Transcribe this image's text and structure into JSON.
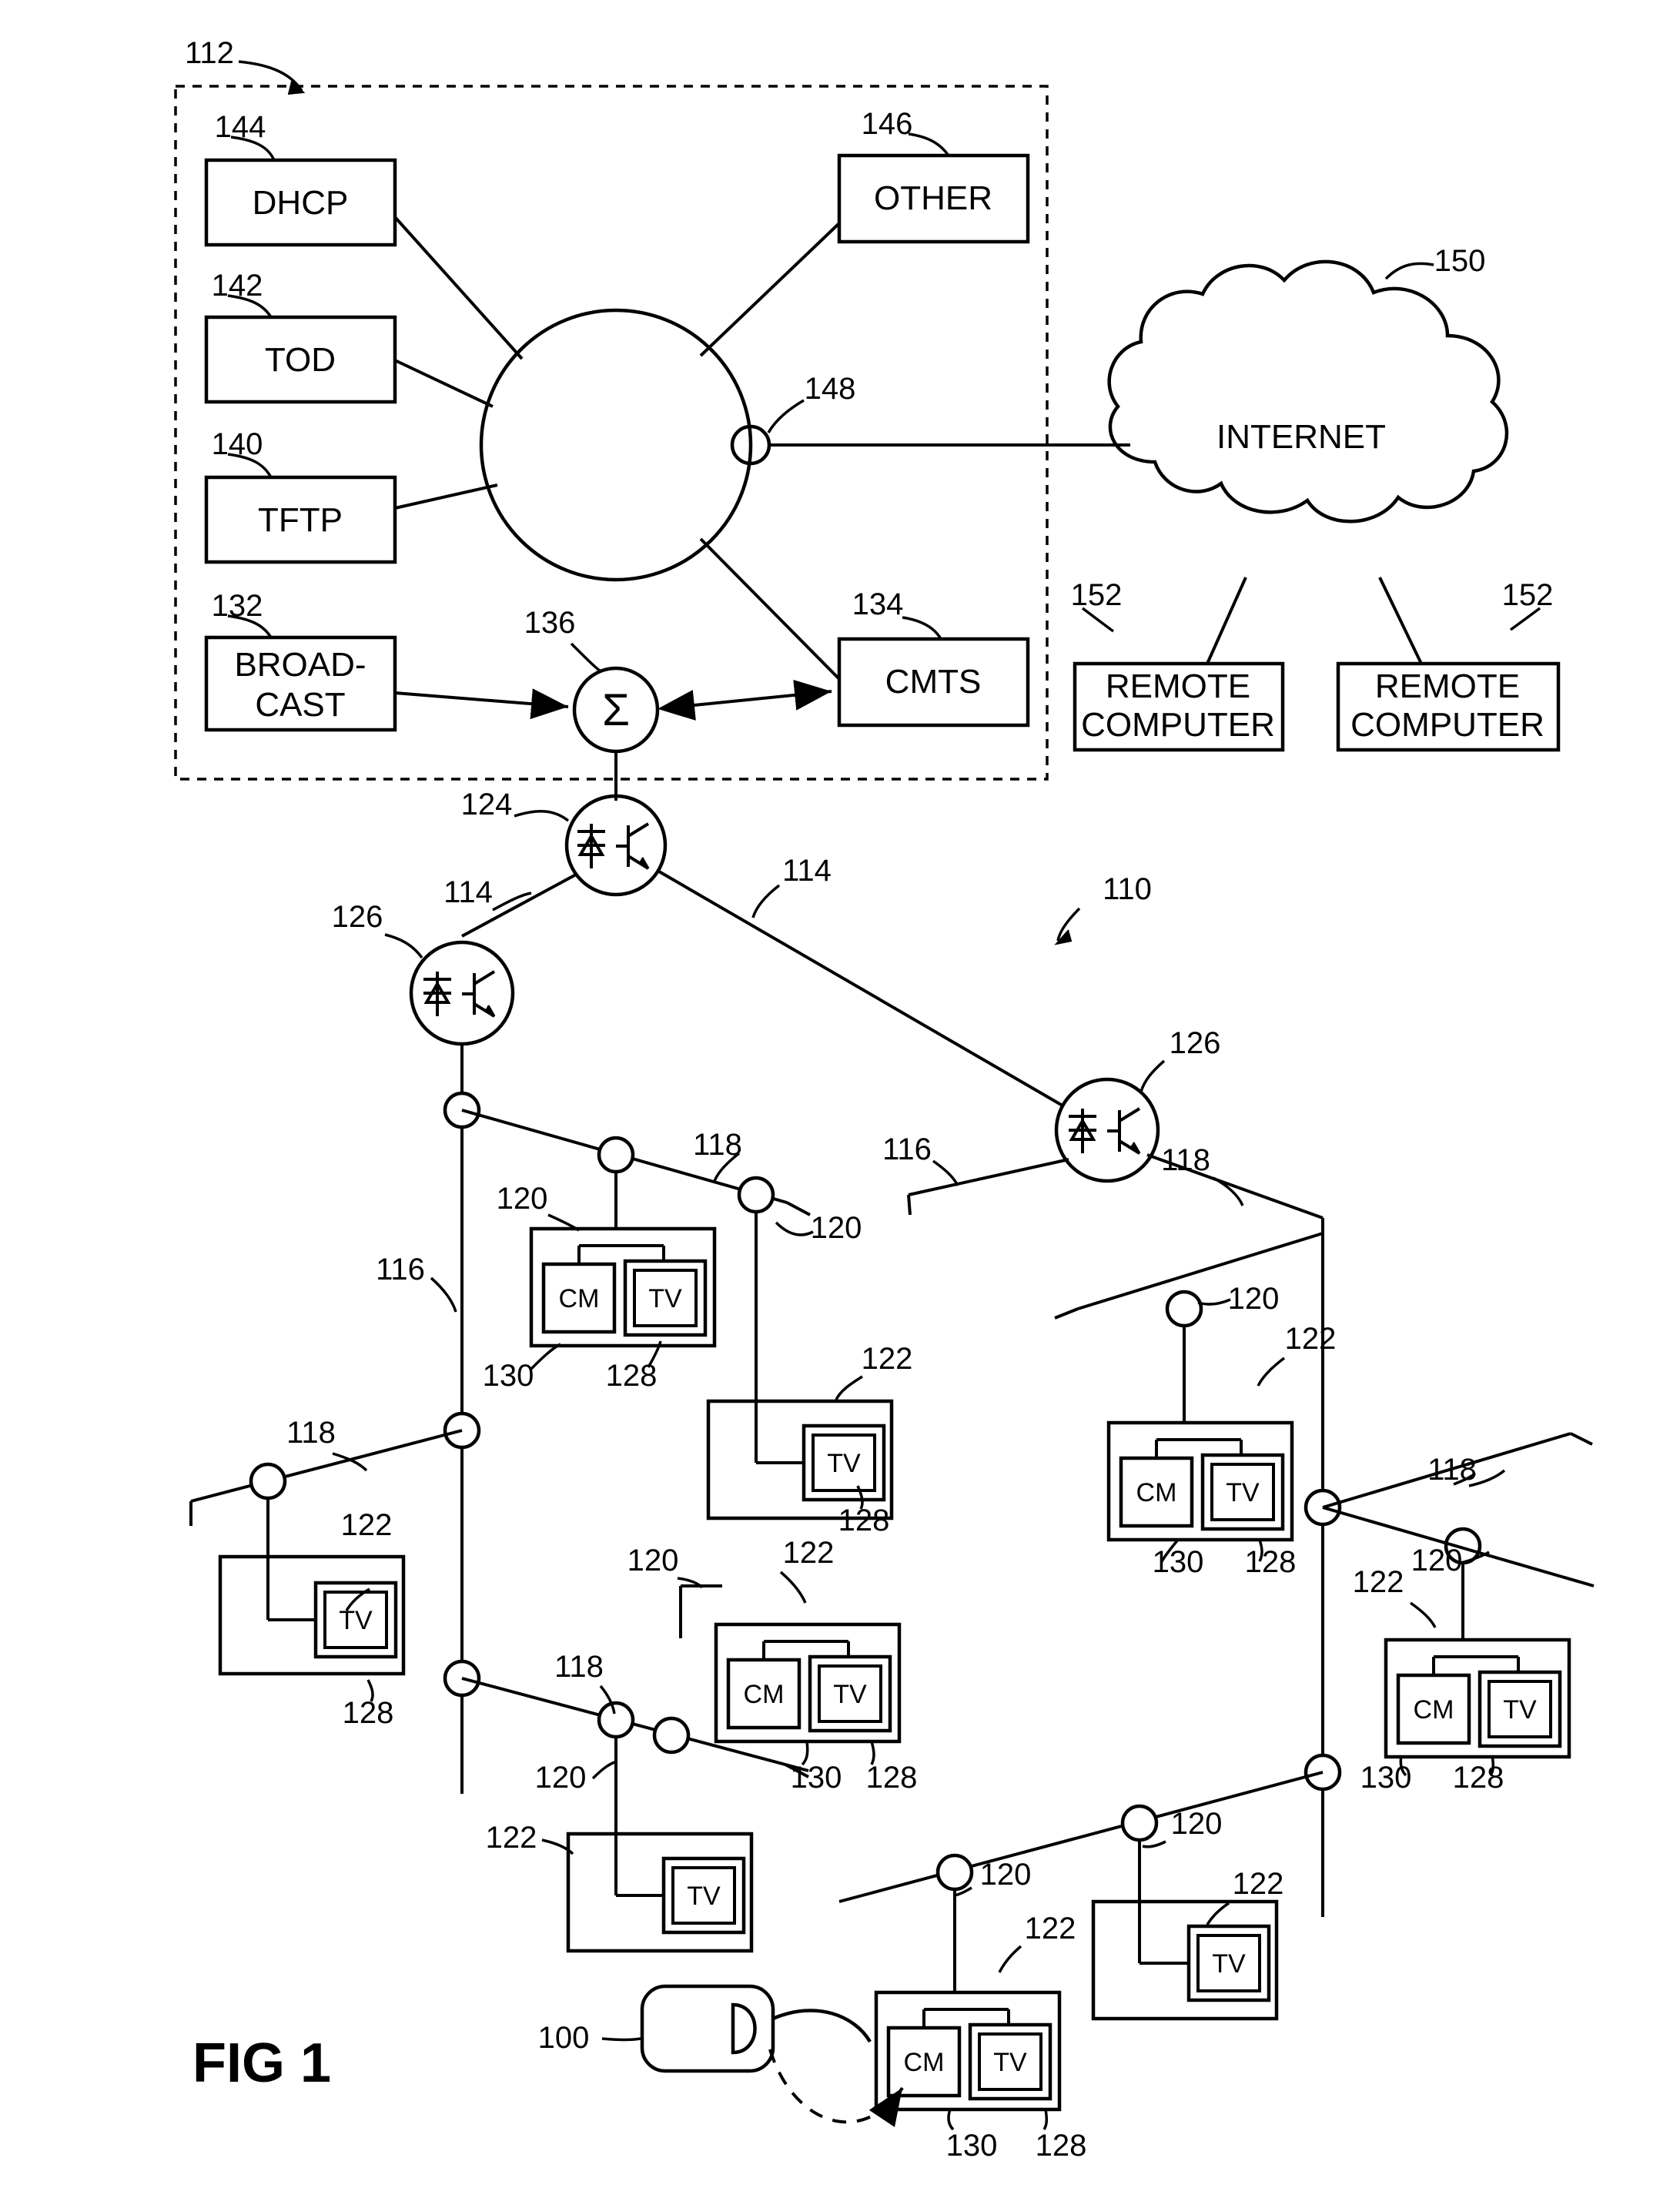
{
  "figure": {
    "label": "FIG 1",
    "title_ref": "100"
  },
  "headend": {
    "ref": "112",
    "servers": [
      {
        "ref": "144",
        "label": "DHCP"
      },
      {
        "ref": "142",
        "label": "TOD"
      },
      {
        "ref": "140",
        "label": "TFTP"
      },
      {
        "ref": "132",
        "label_line1": "BROAD-",
        "label_line2": "CAST"
      }
    ],
    "other": {
      "ref": "146",
      "label": "OTHER"
    },
    "hub_port_ref": "148",
    "cmts": {
      "ref": "134",
      "label": "CMTS"
    },
    "combiner": {
      "ref": "136",
      "symbol": "Σ"
    }
  },
  "internet": {
    "ref": "150",
    "label": "INTERNET",
    "remote_computers": [
      {
        "ref": "152",
        "label_line1": "REMOTE",
        "label_line2": "COMPUTER"
      },
      {
        "ref": "152",
        "label_line1": "REMOTE",
        "label_line2": "COMPUTER"
      }
    ]
  },
  "network": {
    "ref": "110",
    "optical_transmitter_ref": "124",
    "optical_nodes": [
      "126",
      "126"
    ],
    "fiber_refs": [
      "114",
      "114"
    ],
    "coax_refs": [
      "116",
      "116"
    ],
    "tap_refs": [
      "118",
      "118",
      "118",
      "118",
      "118",
      "118"
    ],
    "drop_refs": [
      "120",
      "120",
      "120",
      "120",
      "120",
      "120",
      "120",
      "120",
      "120",
      "120"
    ],
    "home_refs": [
      "122",
      "122",
      "122",
      "122",
      "122",
      "122",
      "122",
      "122"
    ],
    "tv_refs": [
      "128",
      "128",
      "128",
      "128",
      "128",
      "128",
      "128"
    ],
    "cm_refs": [
      "130",
      "130",
      "130",
      "130",
      "130"
    ],
    "cm_label": "CM",
    "tv_label": "TV"
  }
}
